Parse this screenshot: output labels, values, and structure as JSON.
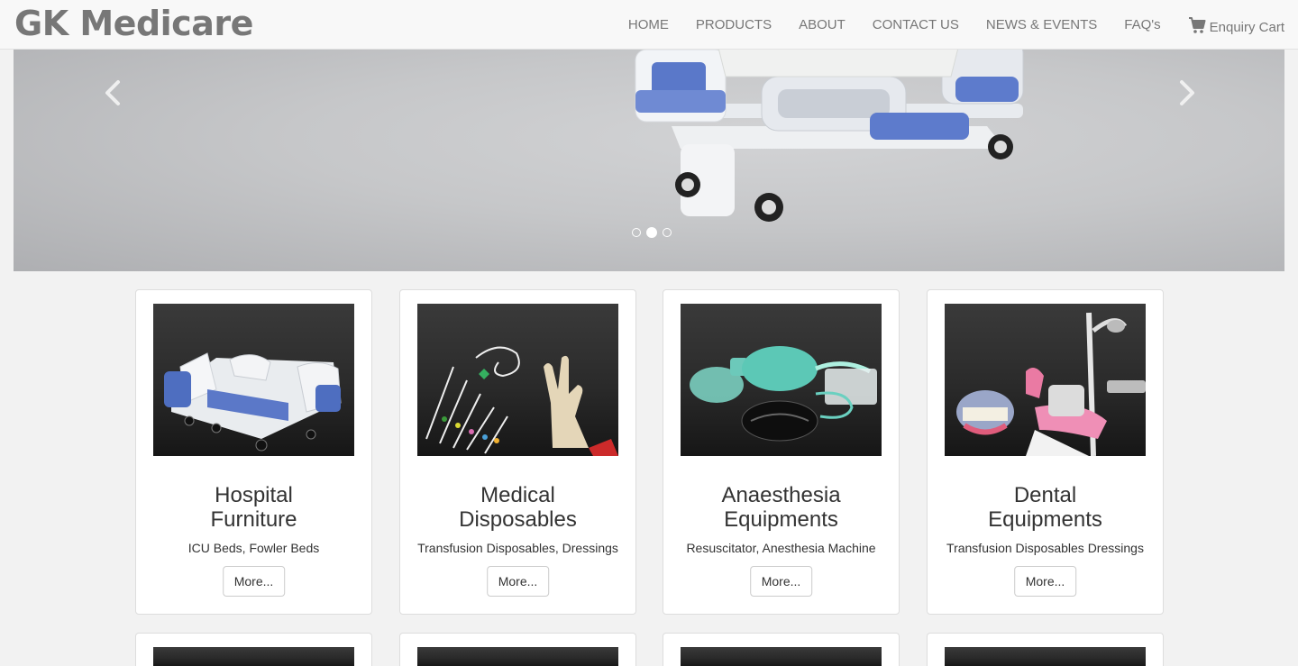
{
  "brand": "GK Medicare",
  "nav": {
    "items": [
      "HOME",
      "PRODUCTS",
      "ABOUT",
      "CONTACT US",
      "NEWS & EVENTS",
      "FAQ's"
    ],
    "cart_label": "Enquiry Cart"
  },
  "carousel": {
    "slide_count": 3,
    "active_slide": 2
  },
  "cards": [
    {
      "title_line1": "Hospital",
      "title_line2": "Furniture",
      "subtitle": "ICU Beds, Fowler Beds",
      "button": "More..."
    },
    {
      "title_line1": "Medical",
      "title_line2": "Disposables",
      "subtitle": "Transfusion Disposables, Dressings",
      "button": "More..."
    },
    {
      "title_line1": "Anaesthesia",
      "title_line2": "Equipments",
      "subtitle": "Resuscitator, Anesthesia Machine",
      "button": "More..."
    },
    {
      "title_line1": "Dental",
      "title_line2": "Equipments",
      "subtitle": "Transfusion Disposables Dressings",
      "button": "More..."
    }
  ],
  "colors": {
    "page_bg": "#f2f2f2",
    "navbar_bg": "#f8f8f8",
    "nav_text": "#777777",
    "card_bg": "#ffffff",
    "image_bg": "#2e2e2e"
  },
  "icons": {
    "cart": "cart-icon",
    "prev": "chevron-left-icon",
    "next": "chevron-right-icon"
  }
}
